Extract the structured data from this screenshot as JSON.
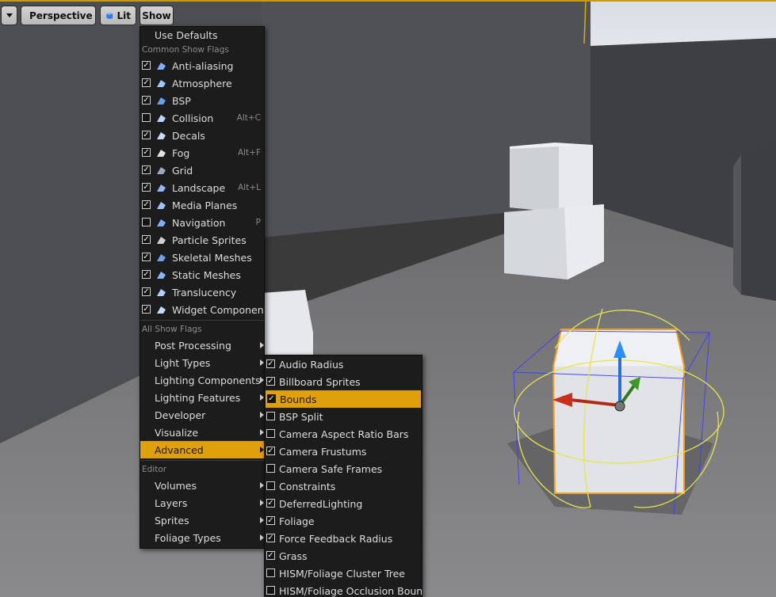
{
  "toolbar": {
    "dropdown_icon": "chevron-down-icon",
    "perspective_label": "Perspective",
    "perspective_icon": "perspective-cube-icon",
    "lit_label": "Lit",
    "lit_icon": "lit-sphere-icon",
    "show_label": "Show"
  },
  "show_menu": {
    "use_defaults": "Use Defaults",
    "common_header": "Common Show Flags",
    "common_flags": [
      {
        "label": "Anti-aliasing",
        "checked": true,
        "shortcut": "",
        "icon": "anti-aliasing-icon"
      },
      {
        "label": "Atmosphere",
        "checked": true,
        "shortcut": "",
        "icon": "atmosphere-icon"
      },
      {
        "label": "BSP",
        "checked": true,
        "shortcut": "",
        "icon": "bsp-icon"
      },
      {
        "label": "Collision",
        "checked": false,
        "shortcut": "Alt+C",
        "icon": "collision-icon"
      },
      {
        "label": "Decals",
        "checked": true,
        "shortcut": "",
        "icon": "decals-icon"
      },
      {
        "label": "Fog",
        "checked": true,
        "shortcut": "Alt+F",
        "icon": "fog-icon"
      },
      {
        "label": "Grid",
        "checked": true,
        "shortcut": "",
        "icon": "grid-icon"
      },
      {
        "label": "Landscape",
        "checked": true,
        "shortcut": "Alt+L",
        "icon": "landscape-icon"
      },
      {
        "label": "Media Planes",
        "checked": true,
        "shortcut": "",
        "icon": "media-planes-icon"
      },
      {
        "label": "Navigation",
        "checked": false,
        "shortcut": "P",
        "icon": "navigation-icon"
      },
      {
        "label": "Particle Sprites",
        "checked": true,
        "shortcut": "",
        "icon": "particle-sprites-icon"
      },
      {
        "label": "Skeletal Meshes",
        "checked": true,
        "shortcut": "",
        "icon": "skeletal-meshes-icon"
      },
      {
        "label": "Static Meshes",
        "checked": true,
        "shortcut": "",
        "icon": "static-meshes-icon"
      },
      {
        "label": "Translucency",
        "checked": true,
        "shortcut": "",
        "icon": "translucency-icon"
      },
      {
        "label": "Widget Components",
        "checked": true,
        "shortcut": "",
        "icon": "widget-components-icon"
      }
    ],
    "all_header": "All Show Flags",
    "all_submenus": [
      "Post Processing",
      "Light Types",
      "Lighting Components",
      "Lighting Features",
      "Developer",
      "Visualize",
      "Advanced"
    ],
    "highlighted_submenu": "Advanced",
    "editor_header": "Editor",
    "editor_submenus": [
      "Volumes",
      "Layers",
      "Sprites",
      "Foliage Types"
    ]
  },
  "advanced_menu": {
    "items": [
      {
        "label": "Audio Radius",
        "checked": true
      },
      {
        "label": "Billboard Sprites",
        "checked": true
      },
      {
        "label": "Bounds",
        "checked": true
      },
      {
        "label": "BSP Split",
        "checked": false
      },
      {
        "label": "Camera Aspect Ratio Bars",
        "checked": false
      },
      {
        "label": "Camera Frustums",
        "checked": true
      },
      {
        "label": "Camera Safe Frames",
        "checked": false
      },
      {
        "label": "Constraints",
        "checked": false
      },
      {
        "label": "DeferredLighting",
        "checked": true
      },
      {
        "label": "Foliage",
        "checked": true
      },
      {
        "label": "Force Feedback Radius",
        "checked": true
      },
      {
        "label": "Grass",
        "checked": true
      },
      {
        "label": "HISM/Foliage Cluster Tree",
        "checked": false
      },
      {
        "label": "HISM/Foliage Occlusion Bounds",
        "checked": false
      }
    ],
    "highlighted_item": "Bounds"
  },
  "colors": {
    "highlight": "#e0a00c",
    "menu_bg": "#1c1c1c",
    "selection_outline": "#f0a020",
    "bounds_sphere": "#e6e64a",
    "bounds_box": "#3c3cff"
  }
}
